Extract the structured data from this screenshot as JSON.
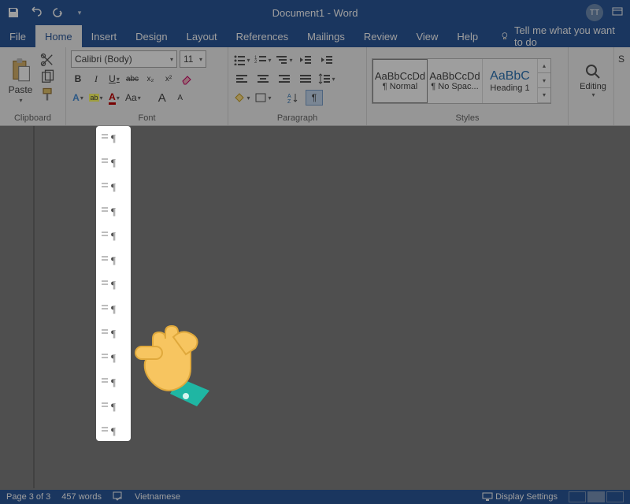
{
  "titlebar": {
    "title": "Document1 - Word",
    "avatar_initials": "TT"
  },
  "tabs": {
    "items": [
      "File",
      "Home",
      "Insert",
      "Design",
      "Layout",
      "References",
      "Mailings",
      "Review",
      "View",
      "Help"
    ],
    "active": "Home",
    "tell_me": "Tell me what you want to do"
  },
  "ribbon": {
    "clipboard": {
      "label": "Clipboard",
      "paste": "Paste"
    },
    "font": {
      "label": "Font",
      "name": "Calibri (Body)",
      "size": "11",
      "bold": "B",
      "italic": "I",
      "underline": "U",
      "strike": "abc",
      "sub": "x₂",
      "sup": "x²",
      "text_effects": "A",
      "highlight": "ab",
      "font_color": "A",
      "change_case": "Aa",
      "grow": "A",
      "shrink": "A"
    },
    "paragraph": {
      "label": "Paragraph",
      "pilcrow": "¶"
    },
    "styles": {
      "label": "Styles",
      "items": [
        {
          "preview": "AaBbCcDd",
          "name": "¶ Normal"
        },
        {
          "preview": "AaBbCcDd",
          "name": "¶ No Spac..."
        },
        {
          "preview": "AaBbC",
          "name": "Heading 1"
        }
      ]
    },
    "editing": {
      "label": "Editing",
      "find_icon_label": "Editing"
    },
    "s_group": "S"
  },
  "document": {
    "pilcrow_glyph": "¶",
    "paragraph_count": 13
  },
  "statusbar": {
    "page": "Page 3 of 3",
    "words": "457 words",
    "language": "Vietnamese",
    "display_settings": "Display Settings"
  }
}
